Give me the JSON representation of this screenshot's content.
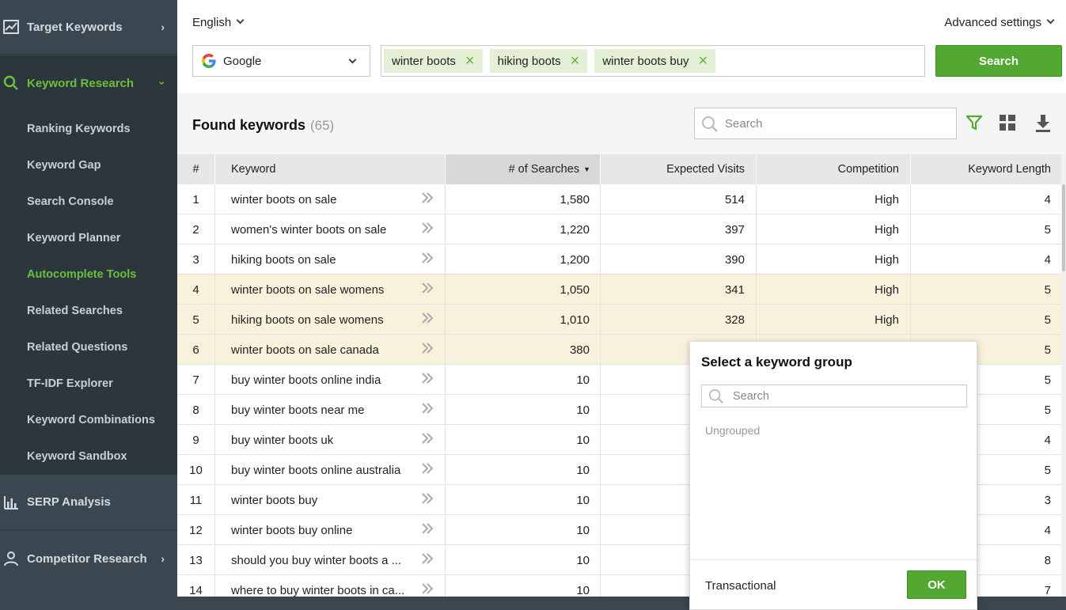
{
  "sidebar": {
    "target_keywords": "Target Keywords",
    "keyword_research": "Keyword Research",
    "items": [
      {
        "label": "Ranking Keywords",
        "active": false
      },
      {
        "label": "Keyword Gap",
        "active": false
      },
      {
        "label": "Search Console",
        "active": false
      },
      {
        "label": "Keyword Planner",
        "active": false
      },
      {
        "label": "Autocomplete Tools",
        "active": true
      },
      {
        "label": "Related Searches",
        "active": false
      },
      {
        "label": "Related Questions",
        "active": false
      },
      {
        "label": "TF-IDF Explorer",
        "active": false
      },
      {
        "label": "Keyword Combinations",
        "active": false
      },
      {
        "label": "Keyword Sandbox",
        "active": false
      }
    ],
    "serp_analysis": "SERP Analysis",
    "competitor_research": "Competitor Research"
  },
  "top": {
    "language": "English",
    "advanced": "Advanced settings",
    "engine": "Google",
    "chips": [
      "winter boots",
      "hiking boots",
      "winter boots buy"
    ],
    "search_button": "Search"
  },
  "found": {
    "title": "Found keywords",
    "count": "(65)",
    "search_placeholder": "Search"
  },
  "table": {
    "headers": {
      "num": "#",
      "keyword": "Keyword",
      "searches": "# of Searches",
      "visits": "Expected Visits",
      "competition": "Competition",
      "length": "Keyword Length"
    },
    "rows": [
      {
        "n": "1",
        "kw": "winter boots on sale",
        "s": "1,580",
        "v": "514",
        "c": "High",
        "l": "4",
        "hl": false
      },
      {
        "n": "2",
        "kw": "women's winter boots on sale",
        "s": "1,220",
        "v": "397",
        "c": "High",
        "l": "5",
        "hl": false
      },
      {
        "n": "3",
        "kw": "hiking boots on sale",
        "s": "1,200",
        "v": "390",
        "c": "High",
        "l": "4",
        "hl": false
      },
      {
        "n": "4",
        "kw": "winter boots on sale womens",
        "s": "1,050",
        "v": "341",
        "c": "High",
        "l": "5",
        "hl": true
      },
      {
        "n": "5",
        "kw": "hiking boots on sale womens",
        "s": "1,010",
        "v": "328",
        "c": "High",
        "l": "5",
        "hl": true
      },
      {
        "n": "6",
        "kw": "winter boots on sale canada",
        "s": "380",
        "v": "",
        "c": "",
        "l": "5",
        "hl": true
      },
      {
        "n": "7",
        "kw": "buy winter boots online india",
        "s": "10",
        "v": "",
        "c": "",
        "l": "5",
        "hl": false
      },
      {
        "n": "8",
        "kw": "buy winter boots near me",
        "s": "10",
        "v": "",
        "c": "",
        "l": "5",
        "hl": false
      },
      {
        "n": "9",
        "kw": "buy winter boots uk",
        "s": "10",
        "v": "",
        "c": "",
        "l": "4",
        "hl": false
      },
      {
        "n": "10",
        "kw": "buy winter boots online australia",
        "s": "10",
        "v": "",
        "c": "",
        "l": "5",
        "hl": false
      },
      {
        "n": "11",
        "kw": "winter boots buy",
        "s": "10",
        "v": "",
        "c": "",
        "l": "3",
        "hl": false
      },
      {
        "n": "12",
        "kw": "winter boots buy online",
        "s": "10",
        "v": "",
        "c": "",
        "l": "4",
        "hl": false
      },
      {
        "n": "13",
        "kw": "should you buy winter boots a ...",
        "s": "10",
        "v": "",
        "c": "",
        "l": "8",
        "hl": false
      },
      {
        "n": "14",
        "kw": "where to buy winter boots in ca...",
        "s": "10",
        "v": "",
        "c": "",
        "l": "7",
        "hl": false
      }
    ]
  },
  "popup": {
    "title": "Select a keyword group",
    "search_placeholder": "Search",
    "group": "Ungrouped",
    "input_value": "Transactional",
    "ok": "OK"
  }
}
